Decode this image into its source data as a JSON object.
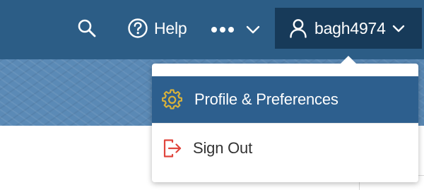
{
  "header": {
    "search_icon": "search-icon",
    "help_label": "Help",
    "help_icon": "question-circle-icon",
    "more_icon": "more-dots-icon",
    "user": {
      "username": "bagh4974",
      "icon": "user-icon"
    }
  },
  "user_menu": {
    "items": [
      {
        "label": "Profile & Preferences",
        "icon": "gear-icon",
        "highlighted": true
      },
      {
        "label": "Sign Out",
        "icon": "sign-out-icon",
        "highlighted": false
      }
    ]
  },
  "colors": {
    "nav_bar": "#2c5d86",
    "user_button": "#173a59",
    "menu_highlight": "#2d5f8e",
    "gear_icon": "#d9b23a",
    "sign_out_icon": "#e0453c"
  }
}
